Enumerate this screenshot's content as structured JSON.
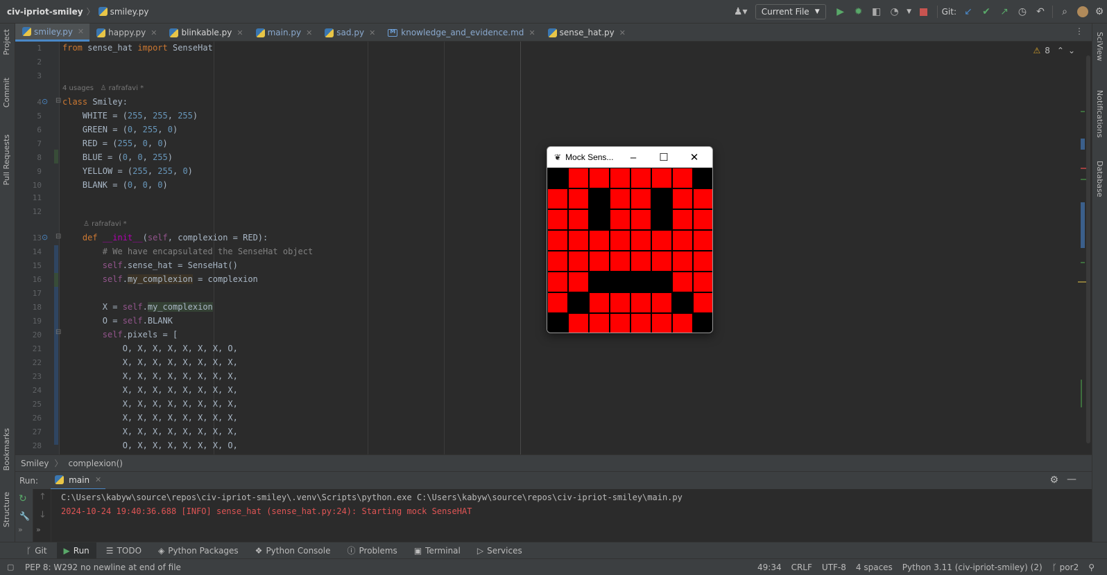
{
  "topbar": {
    "project": "civ-ipriot-smiley",
    "file": "smiley.py",
    "run_config": "Current File",
    "git_label": "Git:"
  },
  "left_strip": [
    "Project",
    "Commit",
    "Pull Requests",
    "Bookmarks",
    "Structure"
  ],
  "right_strip": [
    "SciView",
    "Notifications",
    "Database"
  ],
  "tabs": [
    {
      "label": "smiley.py",
      "active": true,
      "icon": "python-icon"
    },
    {
      "label": "happy.py",
      "active": false,
      "icon": "python-icon"
    },
    {
      "label": "blinkable.py",
      "active": false,
      "icon": "python-icon"
    },
    {
      "label": "main.py",
      "active": false,
      "icon": "python-icon"
    },
    {
      "label": "sad.py",
      "active": false,
      "icon": "python-icon"
    },
    {
      "label": "knowledge_and_evidence.md",
      "active": false,
      "icon": "markdown-icon"
    },
    {
      "label": "sense_hat.py",
      "active": false,
      "icon": "python-icon"
    }
  ],
  "editor": {
    "warnings": "8",
    "hints": {
      "class_usages": "4 usages",
      "class_author": "rafrafavi *",
      "init_author": "rafrafavi *"
    },
    "line_numbers": [
      "1",
      "2",
      "3",
      "4",
      "5",
      "6",
      "7",
      "8",
      "9",
      "10",
      "11",
      "12",
      "13",
      "14",
      "15",
      "16",
      "17",
      "18",
      "19",
      "20",
      "21",
      "22",
      "23",
      "24",
      "25",
      "26",
      "27",
      "28"
    ]
  },
  "breadcrumb": [
    "Smiley",
    "complexion()"
  ],
  "run_panel": {
    "label": "Run:",
    "tab": "main",
    "command": "C:\\Users\\kabyw\\source\\repos\\civ-ipriot-smiley\\.venv\\Scripts\\python.exe C:\\Users\\kabyw\\source\\repos\\civ-ipriot-smiley\\main.py",
    "log": "2024-10-24 19:40:36.688 [INFO] sense_hat (sense_hat.py:24): Starting mock SenseHAT"
  },
  "tool_windows": [
    {
      "label": "Git",
      "icon": "git-icon"
    },
    {
      "label": "Run",
      "icon": "run-icon",
      "active": true
    },
    {
      "label": "TODO",
      "icon": "list-icon"
    },
    {
      "label": "Python Packages",
      "icon": "package-icon"
    },
    {
      "label": "Python Console",
      "icon": "console-icon"
    },
    {
      "label": "Problems",
      "icon": "info-icon"
    },
    {
      "label": "Terminal",
      "icon": "terminal-icon"
    },
    {
      "label": "Services",
      "icon": "services-icon"
    }
  ],
  "status": {
    "message": "PEP 8: W292 no newline at end of file",
    "position": "49:34",
    "line_sep": "CRLF",
    "encoding": "UTF-8",
    "indent": "4 spaces",
    "interpreter": "Python 3.11 (civ-ipriot-smiley) (2)",
    "branch": "por2"
  },
  "mock_window": {
    "title": "Mock Sens...",
    "led_on_color": "#ff0000",
    "led_off_color": "#000000",
    "pixels": [
      [
        0,
        1,
        1,
        1,
        1,
        1,
        1,
        0
      ],
      [
        1,
        1,
        0,
        1,
        1,
        0,
        1,
        1
      ],
      [
        1,
        1,
        0,
        1,
        1,
        0,
        1,
        1
      ],
      [
        1,
        1,
        1,
        1,
        1,
        1,
        1,
        1
      ],
      [
        1,
        1,
        1,
        1,
        1,
        1,
        1,
        1
      ],
      [
        1,
        1,
        0,
        0,
        0,
        0,
        1,
        1
      ],
      [
        1,
        0,
        1,
        1,
        1,
        1,
        0,
        1
      ],
      [
        0,
        1,
        1,
        1,
        1,
        1,
        1,
        0
      ]
    ]
  }
}
